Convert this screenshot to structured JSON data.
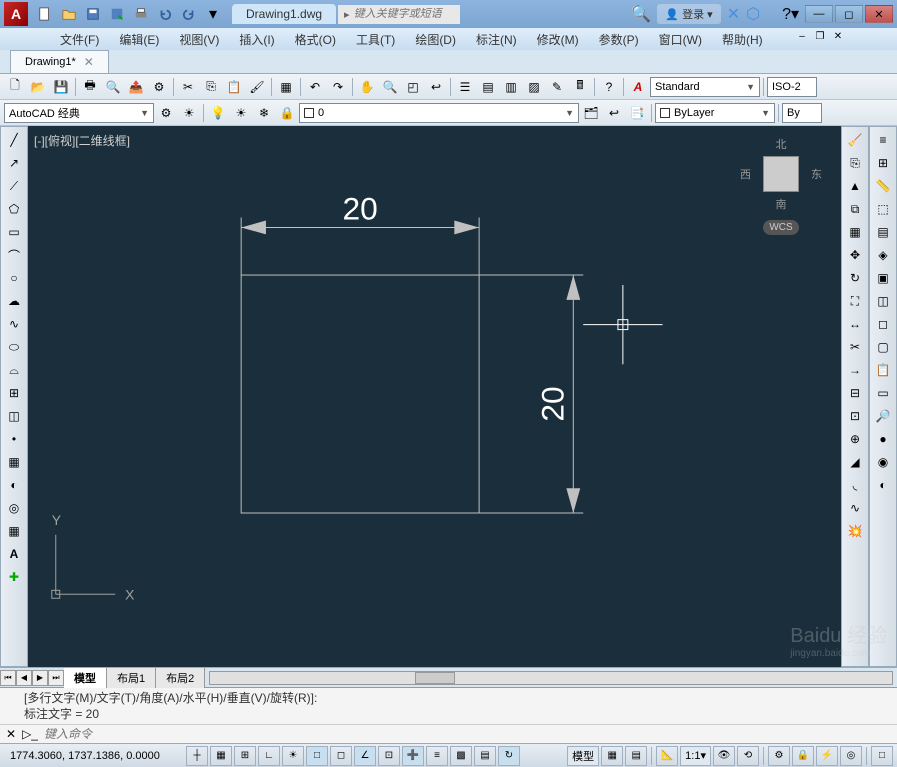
{
  "title": {
    "filename": "Drawing1.dwg",
    "search_placeholder": "键入关键字或短语",
    "login": "登录"
  },
  "menubar": {
    "items": [
      {
        "label": "文件(F)"
      },
      {
        "label": "编辑(E)"
      },
      {
        "label": "视图(V)"
      },
      {
        "label": "插入(I)"
      },
      {
        "label": "格式(O)"
      },
      {
        "label": "工具(T)"
      },
      {
        "label": "绘图(D)"
      },
      {
        "label": "标注(N)"
      },
      {
        "label": "修改(M)"
      },
      {
        "label": "参数(P)"
      },
      {
        "label": "窗口(W)"
      },
      {
        "label": "帮助(H)"
      }
    ]
  },
  "doctab": {
    "name": "Drawing1*"
  },
  "toolbar": {
    "workspace": "AutoCAD 经典",
    "layer_value": "0",
    "style": "Standard",
    "iso": "ISO-2",
    "bylayer": "ByLayer",
    "bylayer2": "By"
  },
  "canvas": {
    "label": "[-][俯视][二维线框]",
    "dim_horizontal": "20",
    "dim_vertical": "20",
    "axis_x": "X",
    "axis_y": "Y"
  },
  "viewcube": {
    "north": "北",
    "south": "南",
    "east": "东",
    "west": "西",
    "wcs": "WCS"
  },
  "layout_tabs": {
    "model": "模型",
    "layout1": "布局1",
    "layout2": "布局2"
  },
  "command": {
    "history_line1": "[多行文字(M)/文字(T)/角度(A)/水平(H)/垂直(V)/旋转(R)]:",
    "history_line2": "标注文字 = 20",
    "prompt": "键入命令"
  },
  "statusbar": {
    "coords": "1774.3060, 1737.1386, 0.0000",
    "model": "模型",
    "scale": "1:1"
  }
}
